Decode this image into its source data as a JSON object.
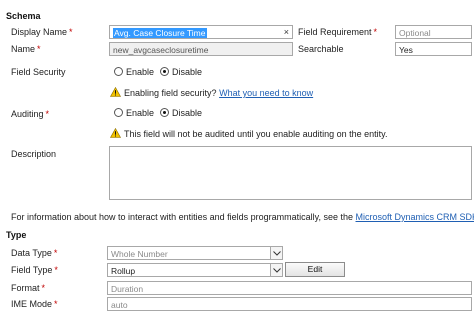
{
  "schema": {
    "title": "Schema",
    "display_name": {
      "label": "Display Name",
      "value_selected": "Avg. Case Closure Time",
      "clear_glyph": "×"
    },
    "field_requirement": {
      "label": "Field Requirement",
      "value": "Optional"
    },
    "name": {
      "label": "Name",
      "value": "new_avgcaseclosuretime"
    },
    "searchable": {
      "label": "Searchable",
      "value": "Yes"
    },
    "field_security": {
      "label": "Field Security",
      "options": [
        "Enable",
        "Disable"
      ],
      "selected": "Disable",
      "note_prefix": "Enabling field security?",
      "note_link": "What you need to know"
    },
    "auditing": {
      "label": "Auditing",
      "options": [
        "Enable",
        "Disable"
      ],
      "selected": "Disable",
      "note": "This field will not be audited until you enable auditing on the entity."
    },
    "description": {
      "label": "Description",
      "value": ""
    }
  },
  "info": {
    "text": "For information about how to interact with entities and fields programmatically, see the",
    "link": "Microsoft Dynamics CRM SDK"
  },
  "type_section": {
    "title": "Type",
    "data_type": {
      "label": "Data Type",
      "value": "Whole Number"
    },
    "field_type": {
      "label": "Field Type",
      "value": "Rollup",
      "edit_label": "Edit"
    },
    "format": {
      "label": "Format",
      "value": "Duration"
    },
    "ime_mode": {
      "label": "IME Mode",
      "value": "auto"
    }
  },
  "colors": {
    "required": "#c00000",
    "link": "#1f5fb3",
    "selection": "#3399ff",
    "warning": "#f2c200"
  },
  "icons": {
    "warning": "warning-icon",
    "dropdown": "chevron-down-icon"
  }
}
